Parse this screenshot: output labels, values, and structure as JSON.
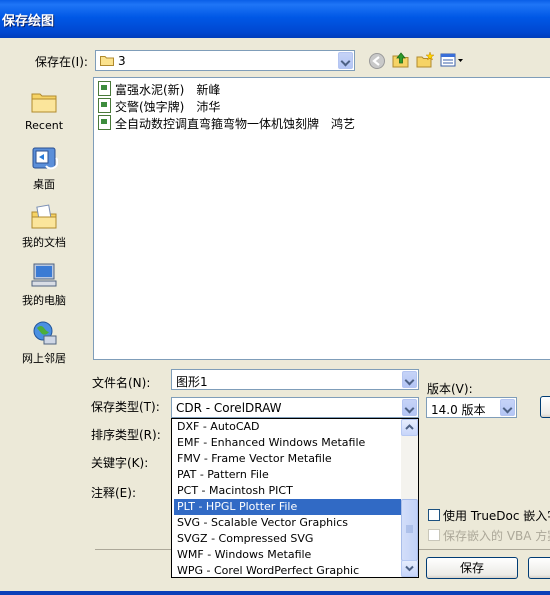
{
  "window": {
    "title": "保存绘图"
  },
  "save_in": {
    "label": "保存在(I):",
    "value": "3"
  },
  "places": [
    {
      "label": "Recent",
      "icon": "recent-folder-icon"
    },
    {
      "label": "桌面",
      "icon": "desktop-icon"
    },
    {
      "label": "我的文档",
      "icon": "my-documents-icon"
    },
    {
      "label": "我的电脑",
      "icon": "my-computer-icon"
    },
    {
      "label": "网上邻居",
      "icon": "network-places-icon"
    }
  ],
  "files": [
    {
      "name": "富强水泥(新)　新峰"
    },
    {
      "name": "交警(蚀字牌)　沛华"
    },
    {
      "name": "全自动数控调直弯箍弯物一体机蚀刻牌　鸿艺"
    }
  ],
  "form": {
    "filename_label": "文件名(N):",
    "filename_value": "图形1",
    "filetype_label": "保存类型(T):",
    "filetype_value": "CDR - CorelDRAW",
    "sort_label": "排序类型(R):",
    "keywords_label": "关键字(K):",
    "notes_label": "注释(E):",
    "version_label": "版本(V):",
    "version_value": "14.0 版本"
  },
  "filetype_options": [
    "DXF - AutoCAD",
    "EMF - Enhanced Windows Metafile",
    "FMV - Frame Vector Metafile",
    "PAT - Pattern File",
    "PCT - Macintosh PICT",
    "PLT - HPGL Plotter File",
    "SVG - Scalable Vector Graphics",
    "SVGZ - Compressed SVG",
    "WMF - Windows Metafile",
    "WPG - Corel WordPerfect Graphic"
  ],
  "selected_option": "PLT - HPGL Plotter File",
  "options": {
    "truedoc_label": "使用 TrueDoc 嵌入字体",
    "vba_label": "保存嵌入的 VBA 方案"
  },
  "buttons": {
    "save": "保存"
  },
  "colors": {
    "titlebar": "#0058e6",
    "selection": "#316ac5",
    "dialog_bg": "#ece9d8"
  }
}
